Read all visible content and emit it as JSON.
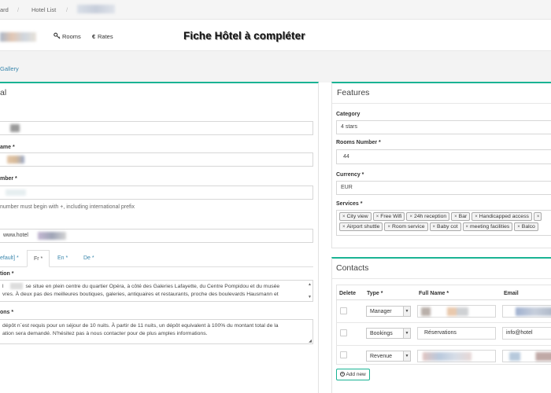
{
  "breadcrumb": {
    "item1": "ard",
    "item2": "Hotel List",
    "sep": "/"
  },
  "header": {
    "nav_rooms": "Rooms",
    "nav_rates": "Rates",
    "title": "Fiche Hôtel à compléter",
    "rooms_icon": "key-icon",
    "rates_icon": "euro-icon",
    "rates_glyph": "€"
  },
  "subnav": {
    "gallery": "Gallery"
  },
  "general": {
    "title": "al",
    "name_label": "ame *",
    "phone_label": "mber *",
    "phone_help": "number must begin with +, including international prefix",
    "website_value": "www.hotel",
    "tabs": {
      "default": "efault] *",
      "fr": "Fr *",
      "en": "En *",
      "de": "De *"
    },
    "desc_label": "tion *",
    "desc_line1_a": "l",
    "desc_line1_b": "se situe en plein centre du quartier Opéra, à côté des Galeries Lafayette, du Centre Pompidou et du musée",
    "desc_line2": "vres. À deux pas des meilleures boutiques, galeries, antiquaires et restaurants, proche des boulevards Hausmann et",
    "cond_label": "ons *",
    "cond_line1": "dépôt n`est requis pour un séjour de 10 nuits. À partir de 11 nuits, un dépôt equivalent à 100% du montant total de la",
    "cond_line2": "ation sera demandé. N'hésitez pas à nous contacter pour de plus amples informations."
  },
  "features": {
    "title": "Features",
    "category_label": "Category",
    "category_value": "4 stars",
    "rooms_label": "Rooms Number *",
    "rooms_value": "44",
    "currency_label": "Currency *",
    "currency_value": "EUR",
    "services_label": "Services *",
    "services": [
      "City view",
      "Free Wifi",
      "24h reception",
      "Bar",
      "Handicapped access",
      "Airport shuttle",
      "Room service",
      "Baby cot",
      "meeting facilities",
      "Balco"
    ],
    "remove_glyph": "×"
  },
  "contacts": {
    "title": "Contacts",
    "headers": {
      "delete": "Delete",
      "type": "Type *",
      "name": "Full Name *",
      "email": "Email"
    },
    "rows": [
      {
        "type": "Manager",
        "name": "",
        "email": ""
      },
      {
        "type": "Bookings",
        "name": "Réservations",
        "email": "info@hotel"
      },
      {
        "type": "Revenue",
        "name": "",
        "email": ""
      }
    ],
    "add_button": "Add new",
    "dropdown_glyph": "▼"
  }
}
